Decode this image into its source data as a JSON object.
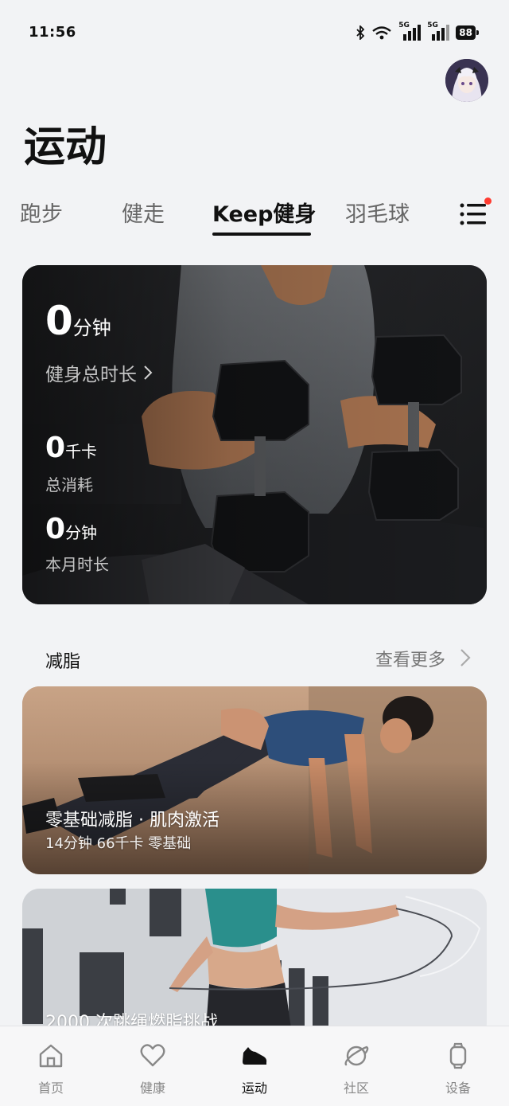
{
  "status": {
    "time": "11:56",
    "network1": "5G",
    "network2": "5G",
    "battery": "88"
  },
  "header": {
    "title": "运动"
  },
  "tabs": [
    {
      "label": "跑步",
      "active": false
    },
    {
      "label": "健走",
      "active": false
    },
    {
      "label": "Keep健身",
      "active": true
    },
    {
      "label": "羽毛球",
      "active": false
    }
  ],
  "hero": {
    "total_value": "0",
    "total_unit": "分钟",
    "total_label": "健身总时长",
    "calories_value": "0",
    "calories_unit": "千卡",
    "calories_label": "总消耗",
    "month_value": "0",
    "month_unit": "分钟",
    "month_label": "本月时长"
  },
  "section": {
    "title": "减脂",
    "see_more": "查看更多"
  },
  "courses": [
    {
      "title": "零基础减脂 · 肌肉激活",
      "meta": "14分钟 66千卡 零基础"
    },
    {
      "title": "2000 次跳绳燃脂挑战"
    }
  ],
  "bottom_nav": [
    {
      "label": "首页",
      "icon": "home-icon",
      "active": false
    },
    {
      "label": "健康",
      "icon": "heart-icon",
      "active": false
    },
    {
      "label": "运动",
      "icon": "shoe-icon",
      "active": true
    },
    {
      "label": "社区",
      "icon": "planet-icon",
      "active": false
    },
    {
      "label": "设备",
      "icon": "watch-icon",
      "active": false
    }
  ]
}
